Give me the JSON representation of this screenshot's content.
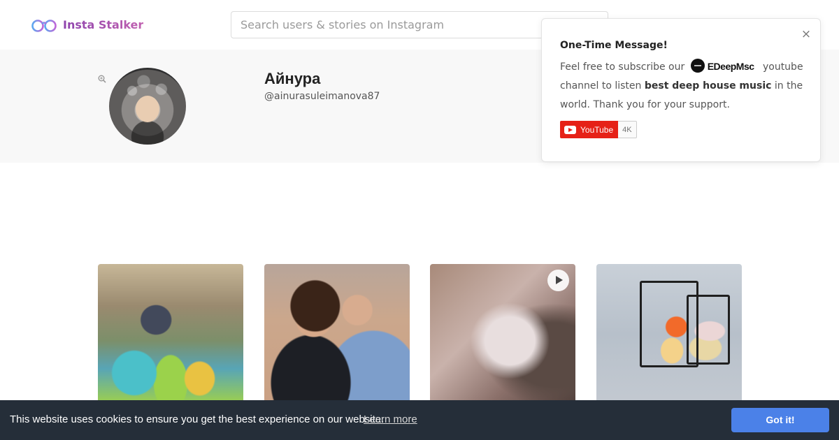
{
  "header": {
    "logo_text": "Insta Stalker",
    "logo_icon": "glasses-icon",
    "search_placeholder": "Search users & stories on Instagram"
  },
  "profile": {
    "name": "Айнура",
    "handle": "@ainurasuleimanova87",
    "zoom_icon": "zoom-in-icon"
  },
  "popup": {
    "title": "One-Time Message!",
    "text_prefix": "Feel free to subscribe our",
    "brand": "EDeepMsc",
    "text_suffix": "youtube channel to listen",
    "bold_phrase": "best deep house music",
    "text_end": "in the world. Thank you for your support.",
    "youtube_label": "YouTube",
    "youtube_count": "4K",
    "close_symbol": "×"
  },
  "posts": [
    {
      "kind": "image",
      "icon": ""
    },
    {
      "kind": "image",
      "icon": ""
    },
    {
      "kind": "video",
      "icon": "play-icon"
    },
    {
      "kind": "image",
      "icon": ""
    }
  ],
  "cookie": {
    "message": "This website uses cookies to ensure you get the best experience on our website.",
    "learn_more": "Learn more",
    "accept": "Got it!"
  },
  "colors": {
    "brand_purple": "#9b59b6",
    "cookie_bg": "#252e39",
    "cookie_button": "#4b81e8",
    "youtube_red": "#e62117"
  }
}
